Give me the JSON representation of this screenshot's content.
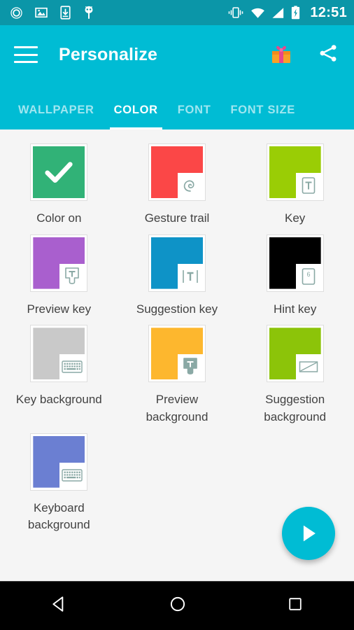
{
  "status_bar": {
    "background_color": "#0b96a8",
    "icons": [
      "ring-icon",
      "image-icon",
      "download-to-phone-icon",
      "android-bug-icon"
    ],
    "right_icons": [
      "vibrate-icon",
      "wifi-icon",
      "signal-icon",
      "battery-charging-icon"
    ],
    "clock": "12:51"
  },
  "app_bar": {
    "background_color": "#00bcd4",
    "menu_icon": "hamburger-menu-icon",
    "title": "Personalize",
    "gift_icon": "gift-icon",
    "share_icon": "share-icon"
  },
  "tabs": {
    "active_index": 1,
    "items": [
      {
        "label": "WALLPAPER"
      },
      {
        "label": "COLOR"
      },
      {
        "label": "FONT"
      },
      {
        "label": "FONT SIZE"
      }
    ]
  },
  "color_grid": {
    "items": [
      {
        "label": "Color on",
        "color": "#31b277",
        "icon": "check-icon",
        "notch": false
      },
      {
        "label": "Gesture trail",
        "color": "#fb4747",
        "icon": "swirl-icon",
        "notch": true
      },
      {
        "label": "Key",
        "color": "#9acd05",
        "icon": "key-t-icon",
        "notch": true
      },
      {
        "label": "Preview key",
        "color": "#a95fce",
        "icon": "preview-key-t-icon",
        "notch": true
      },
      {
        "label": "Suggestion key",
        "color": "#0e93c7",
        "icon": "suggestion-t-icon",
        "notch": true
      },
      {
        "label": "Hint key",
        "color": "#000000",
        "icon": "hint-key-6-icon",
        "notch": true
      },
      {
        "label": "Key background",
        "color": "#c9c9c9",
        "icon": "keyboard-icon",
        "notch": true
      },
      {
        "label": "Preview background",
        "color": "#fdb72e",
        "icon": "preview-filled-t-icon",
        "notch": true
      },
      {
        "label": "Suggestion background",
        "color": "#8cc409",
        "icon": "suggestion-bar-icon",
        "notch": true
      },
      {
        "label": "Keyboard background",
        "color": "#6b7fd2",
        "icon": "keyboard-icon",
        "notch": true
      }
    ]
  },
  "fab": {
    "icon": "play-icon",
    "color": "#00bcd4"
  },
  "nav_bar": {
    "buttons": [
      "back-icon",
      "home-icon",
      "recents-icon"
    ]
  }
}
